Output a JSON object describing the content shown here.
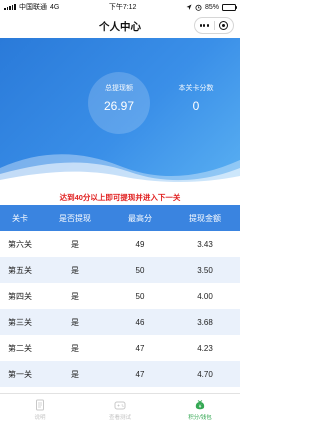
{
  "status_bar": {
    "carrier": "中国联通",
    "network": "4G",
    "time": "下午7:12",
    "battery": "85%"
  },
  "nav": {
    "title": "个人中心"
  },
  "stats": {
    "total_label": "总提现额",
    "total_value": "26.97",
    "score_label": "本关卡分数",
    "score_value": "0"
  },
  "notice": "达到40分以上即可提现并进入下一关",
  "table": {
    "headers": [
      "关卡",
      "是否提现",
      "最高分",
      "提现金额"
    ],
    "rows": [
      [
        "第六关",
        "是",
        "49",
        "3.43"
      ],
      [
        "第五关",
        "是",
        "50",
        "3.50"
      ],
      [
        "第四关",
        "是",
        "50",
        "4.00"
      ],
      [
        "第三关",
        "是",
        "46",
        "3.68"
      ],
      [
        "第二关",
        "是",
        "47",
        "4.23"
      ],
      [
        "第一关",
        "是",
        "47",
        "4.70"
      ]
    ]
  },
  "tabbar": {
    "items": [
      {
        "label": "说明",
        "icon": "document-icon",
        "active": false
      },
      {
        "label": "查看测试",
        "icon": "game-icon",
        "active": false
      },
      {
        "label": "积分/钱包",
        "icon": "wallet-icon",
        "active": true
      }
    ]
  },
  "colors": {
    "primary": "#3a84e0",
    "notice": "#e02020",
    "active_tab": "#34a853"
  }
}
